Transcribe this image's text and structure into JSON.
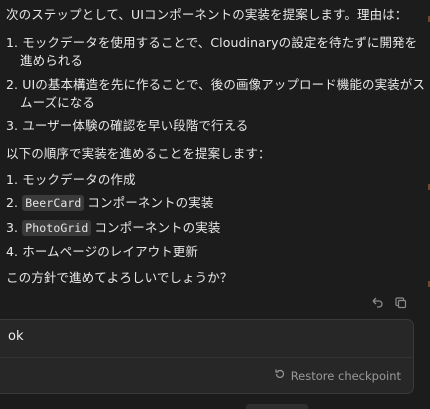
{
  "assistant_message": {
    "intro": "次のステップとして、UIコンポーネントの実装を提案します。理由は：",
    "reasons": [
      {
        "num": "1.",
        "line1": "モックデータを使用することで、Cloudinaryの設定を待たずに開発を",
        "line2": "進められる"
      },
      {
        "num": "2.",
        "line1": "UIの基本構造を先に作ることで、後の画像アップロード機能の実装がス",
        "line2": "ムーズになる"
      },
      {
        "num": "3.",
        "line1": "ユーザー体験の確認を早い段階で行える"
      }
    ],
    "order_intro": "以下の順序で実装を進めることを提案します：",
    "steps": [
      {
        "num": "1.",
        "text": "モックデータの作成"
      },
      {
        "num": "2.",
        "code": "BeerCard",
        "text": "コンポーネントの実装"
      },
      {
        "num": "3.",
        "code": "PhotoGrid",
        "text": "コンポーネントの実装"
      },
      {
        "num": "4.",
        "text": "ホームページのレイアウト更新"
      }
    ],
    "question": "この方針で進めてよろしいでしょうか？"
  },
  "user_message": {
    "text": "ok",
    "restore_label": "Restore checkpoint"
  },
  "icons": {
    "retry": "retry-icon",
    "copy": "copy-icon",
    "restore": "restore-icon"
  }
}
